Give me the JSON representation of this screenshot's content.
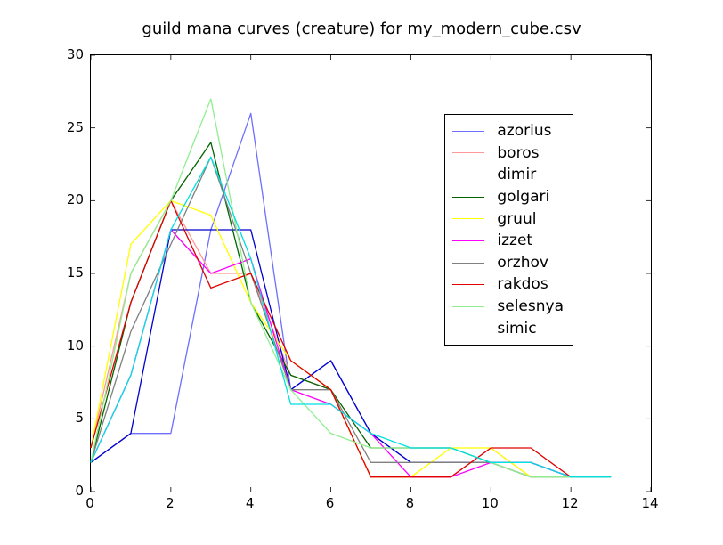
{
  "chart_data": {
    "type": "line",
    "title": "guild mana curves (creature) for my_modern_cube.csv",
    "xlabel": "",
    "ylabel": "",
    "xlim": [
      0,
      14
    ],
    "ylim": [
      0,
      30
    ],
    "xticks": [
      0,
      2,
      4,
      6,
      8,
      10,
      12,
      14
    ],
    "yticks": [
      0,
      5,
      10,
      15,
      20,
      25,
      30
    ],
    "x": [
      0,
      1,
      2,
      3,
      4,
      5,
      6,
      7,
      8,
      9,
      10,
      11,
      12,
      13
    ],
    "series": [
      {
        "name": "azorius",
        "color": "#6E6EFF",
        "values": [
          2,
          4,
          4,
          18,
          26,
          7,
          9,
          4,
          2,
          2,
          2,
          2,
          1,
          1
        ]
      },
      {
        "name": "boros",
        "color": "#FF9999",
        "values": [
          3,
          15,
          20,
          15,
          15,
          8,
          7,
          1,
          1,
          1,
          3,
          1,
          1,
          1
        ]
      },
      {
        "name": "dimir",
        "color": "#0000CC",
        "values": [
          2,
          4,
          18,
          18,
          18,
          7,
          9,
          4,
          2,
          2,
          2,
          2,
          1,
          1
        ]
      },
      {
        "name": "golgari",
        "color": "#006400",
        "values": [
          2,
          13,
          20,
          24,
          13,
          8,
          7,
          3,
          3,
          3,
          2,
          1,
          1,
          1
        ]
      },
      {
        "name": "gruul",
        "color": "#FFFF00",
        "values": [
          3,
          17,
          20,
          19,
          13,
          9,
          7,
          1,
          1,
          3,
          3,
          1,
          1,
          1
        ]
      },
      {
        "name": "izzet",
        "color": "#FF00FF",
        "values": [
          2,
          8,
          18,
          15,
          16,
          7,
          6,
          4,
          1,
          1,
          2,
          2,
          1,
          1
        ]
      },
      {
        "name": "orzhov",
        "color": "#808080",
        "values": [
          2,
          11,
          17,
          23,
          15,
          7,
          7,
          2,
          2,
          2,
          2,
          1,
          1,
          1
        ]
      },
      {
        "name": "rakdos",
        "color": "#E00000",
        "values": [
          3,
          13,
          20,
          14,
          15,
          9,
          7,
          1,
          1,
          1,
          3,
          3,
          1,
          1
        ]
      },
      {
        "name": "selesnya",
        "color": "#90EE90",
        "values": [
          2,
          15,
          20,
          27,
          13,
          7,
          4,
          3,
          3,
          3,
          2,
          1,
          1,
          1
        ]
      },
      {
        "name": "simic",
        "color": "#00E0E0",
        "values": [
          2,
          8,
          18,
          23,
          16,
          6,
          6,
          4,
          3,
          3,
          2,
          2,
          1,
          1
        ]
      }
    ],
    "legend": {
      "position": "upper right",
      "entries": [
        "azorius",
        "boros",
        "dimir",
        "golgari",
        "gruul",
        "izzet",
        "orzhov",
        "rakdos",
        "selesnya",
        "simic"
      ]
    }
  }
}
